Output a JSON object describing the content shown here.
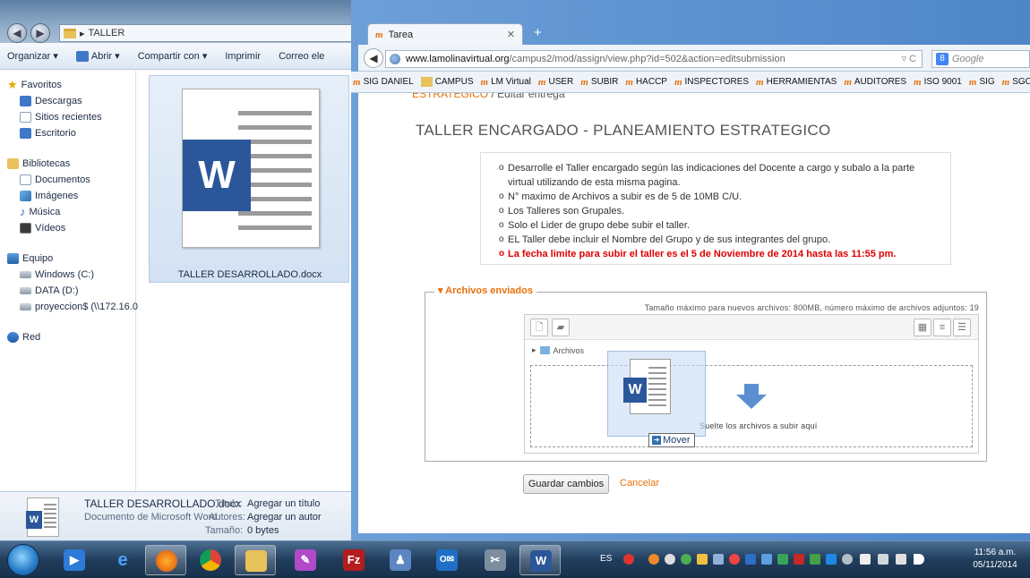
{
  "explorer": {
    "breadcrumb": "TALLER",
    "toolbar": {
      "organize": "Organizar ▾",
      "open": "Abrir ▾",
      "share": "Compartir con ▾",
      "print": "Imprimir",
      "email": "Correo ele"
    },
    "sidebar": {
      "favorites": "Favoritos",
      "downloads": "Descargas",
      "recent": "Sitios recientes",
      "desktop": "Escritorio",
      "libraries": "Bibliotecas",
      "documents": "Documentos",
      "images": "Imágenes",
      "music": "Música",
      "videos": "Vídeos",
      "computer": "Equipo",
      "drive_c": "Windows (C:)",
      "drive_d": "DATA (D:)",
      "network_share": "proyeccion$ (\\\\172.16.0",
      "network": "Red"
    },
    "file_name": "TALLER DESARROLLADO.docx",
    "details": {
      "file_name": "TALLER DESARROLLADO.docx",
      "file_type": "Documento de Microsoft Word",
      "title_label": "Título:",
      "title_value": "Agregar un título",
      "authors_label": "Autores:",
      "authors_value": "Agregar un autor",
      "size_label": "Tamaño:",
      "size_value": "0 bytes"
    }
  },
  "browser": {
    "tab_title": "Tarea",
    "url_host": "www.lamolinavirtual.org",
    "url_path": "/campus2/mod/assign/view.php?id=502&action=editsubmission",
    "search_placeholder": "Google",
    "bookmarks": [
      "SIG DANIEL",
      "CAMPUS",
      "LM Virtual",
      "USER",
      "SUBIR",
      "HACCP",
      "INSPECTORES",
      "HERRAMIENTAS",
      "AUDITORES",
      "ISO 9001",
      "SIG",
      "SGCIA"
    ],
    "breadcrumb_link": "ESTRATEGICO",
    "breadcrumb_current": "/ Editar entrega",
    "page_heading": "TALLER ENCARGADO - PLANEAMIENTO ESTRATEGICO",
    "instructions": [
      "Desarrolle el Taller encargado según las indicaciones del Docente a cargo y subalo a la parte virtual utilizando de esta misma pagina.",
      "N° maximo de Archivos a subir es de 5 de 10MB C/U.",
      "Los Talleres son Grupales.",
      "Solo el Lider de grupo debe subir el taller.",
      "EL Taller debe incluir el Nombre del Grupo y de sus integrantes del grupo."
    ],
    "deadline": "La fecha limite para subir el taller es el 5 de Noviembre de 2014 hasta las 11:55 pm.",
    "files_legend": "▾ Archivos enviados",
    "files_maxinfo": "Tamaño máximo para nuevos archivos: 800MB, número máximo de archivos adjuntos: 19",
    "folder_path": "Archivos",
    "drop_text": "Suelte los archivos a subir aquí",
    "move_label": "Mover",
    "save_button": "Guardar cambios",
    "cancel_link": "Cancelar"
  },
  "taskbar": {
    "language": "ES",
    "time": "11:56 a.m.",
    "date": "05/11/2014"
  },
  "colors": {
    "moodle_orange": "#e8710a",
    "deadline_red": "#dd0000",
    "word_blue": "#2b579a"
  }
}
